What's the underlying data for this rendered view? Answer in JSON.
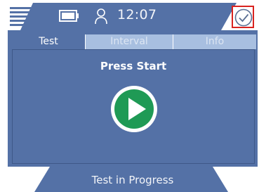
{
  "header": {
    "menu_icon": "hamburger-menu-icon",
    "battery_icon": "battery-icon",
    "user_icon": "user-icon",
    "time": "12:07",
    "status_icon": "checkmark-circle-icon"
  },
  "tabs": [
    {
      "label": "Test",
      "active": true
    },
    {
      "label": "Interval",
      "active": false
    },
    {
      "label": "Info",
      "active": false
    }
  ],
  "main": {
    "prompt": "Press Start",
    "start_icon": "play-icon"
  },
  "footer": {
    "status": "Test in Progress"
  },
  "colors": {
    "panel": "#5471a6",
    "tab_inactive": "#a8bfe0",
    "start_green": "#1f9a55",
    "highlight_red": "#d9231f"
  }
}
